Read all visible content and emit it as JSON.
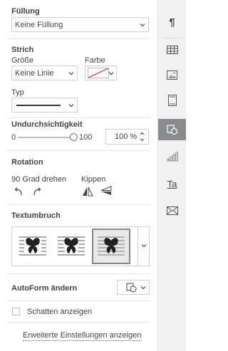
{
  "fill": {
    "title": "Füllung",
    "value": "Keine Füllung"
  },
  "stroke": {
    "title": "Strich",
    "size_label": "Größe",
    "size_value": "Keine Linie",
    "color_label": "Farbe",
    "type_label": "Typ"
  },
  "opacity": {
    "title": "Undurchsichtigkeit",
    "min": "0",
    "max": "100",
    "value": "100 %",
    "level": 100
  },
  "rotation": {
    "title": "Rotation",
    "rotate_label": "90 Grad drehen",
    "flip_label": "Kippen"
  },
  "wrap": {
    "title": "Textumbruch"
  },
  "autoshape": {
    "title": "AutoForm ändern"
  },
  "shadow": {
    "label": "Schatten anzeigen",
    "checked": false
  },
  "advanced": {
    "label": "Erweiterte Einstellungen anzeigen"
  },
  "rail": {
    "items": [
      {
        "icon": "paragraph-icon"
      },
      {
        "icon": "table-icon"
      },
      {
        "icon": "image-icon"
      },
      {
        "icon": "header-footer-icon"
      },
      {
        "icon": "shape-icon",
        "active": true
      },
      {
        "icon": "chart-icon"
      },
      {
        "icon": "textart-icon"
      },
      {
        "icon": "mail-merge-icon"
      }
    ],
    "paragraph_glyph": "¶",
    "textart_glyph": "Ta"
  }
}
